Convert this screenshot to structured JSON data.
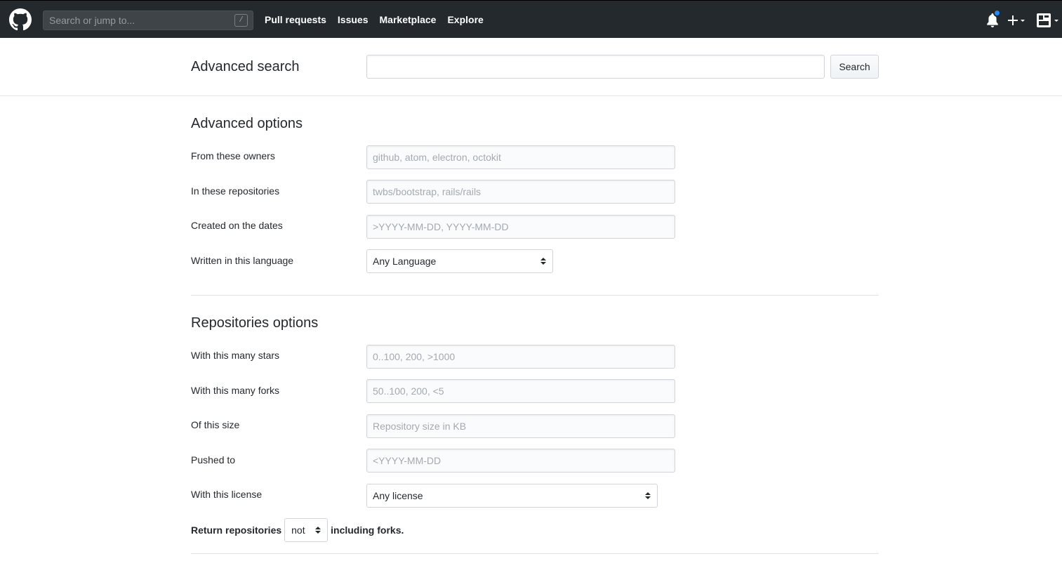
{
  "header": {
    "search_placeholder": "Search or jump to...",
    "slash_key": "/",
    "nav": {
      "pull_requests": "Pull requests",
      "issues": "Issues",
      "marketplace": "Marketplace",
      "explore": "Explore"
    },
    "notification_dot_color": "#2188ff"
  },
  "top": {
    "title": "Advanced search",
    "query_value": "",
    "search_button": "Search"
  },
  "advanced": {
    "heading": "Advanced options",
    "owners": {
      "label": "From these owners",
      "placeholder": "github, atom, electron, octokit"
    },
    "repos": {
      "label": "In these repositories",
      "placeholder": "twbs/bootstrap, rails/rails"
    },
    "dates": {
      "label": "Created on the dates",
      "placeholder": ">YYYY-MM-DD, YYYY-MM-DD"
    },
    "language": {
      "label": "Written in this language",
      "selected": "Any Language"
    }
  },
  "repositories": {
    "heading": "Repositories options",
    "stars": {
      "label": "With this many stars",
      "placeholder": "0..100, 200, >1000"
    },
    "forks": {
      "label": "With this many forks",
      "placeholder": "50..100, 200, <5"
    },
    "size": {
      "label": "Of this size",
      "placeholder": "Repository size in KB"
    },
    "pushed": {
      "label": "Pushed to",
      "placeholder": "<YYYY-MM-DD"
    },
    "license": {
      "label": "With this license",
      "selected": "Any license"
    },
    "forks_clause": {
      "prefix": "Return repositories",
      "selected": "not",
      "suffix": "including forks."
    }
  }
}
